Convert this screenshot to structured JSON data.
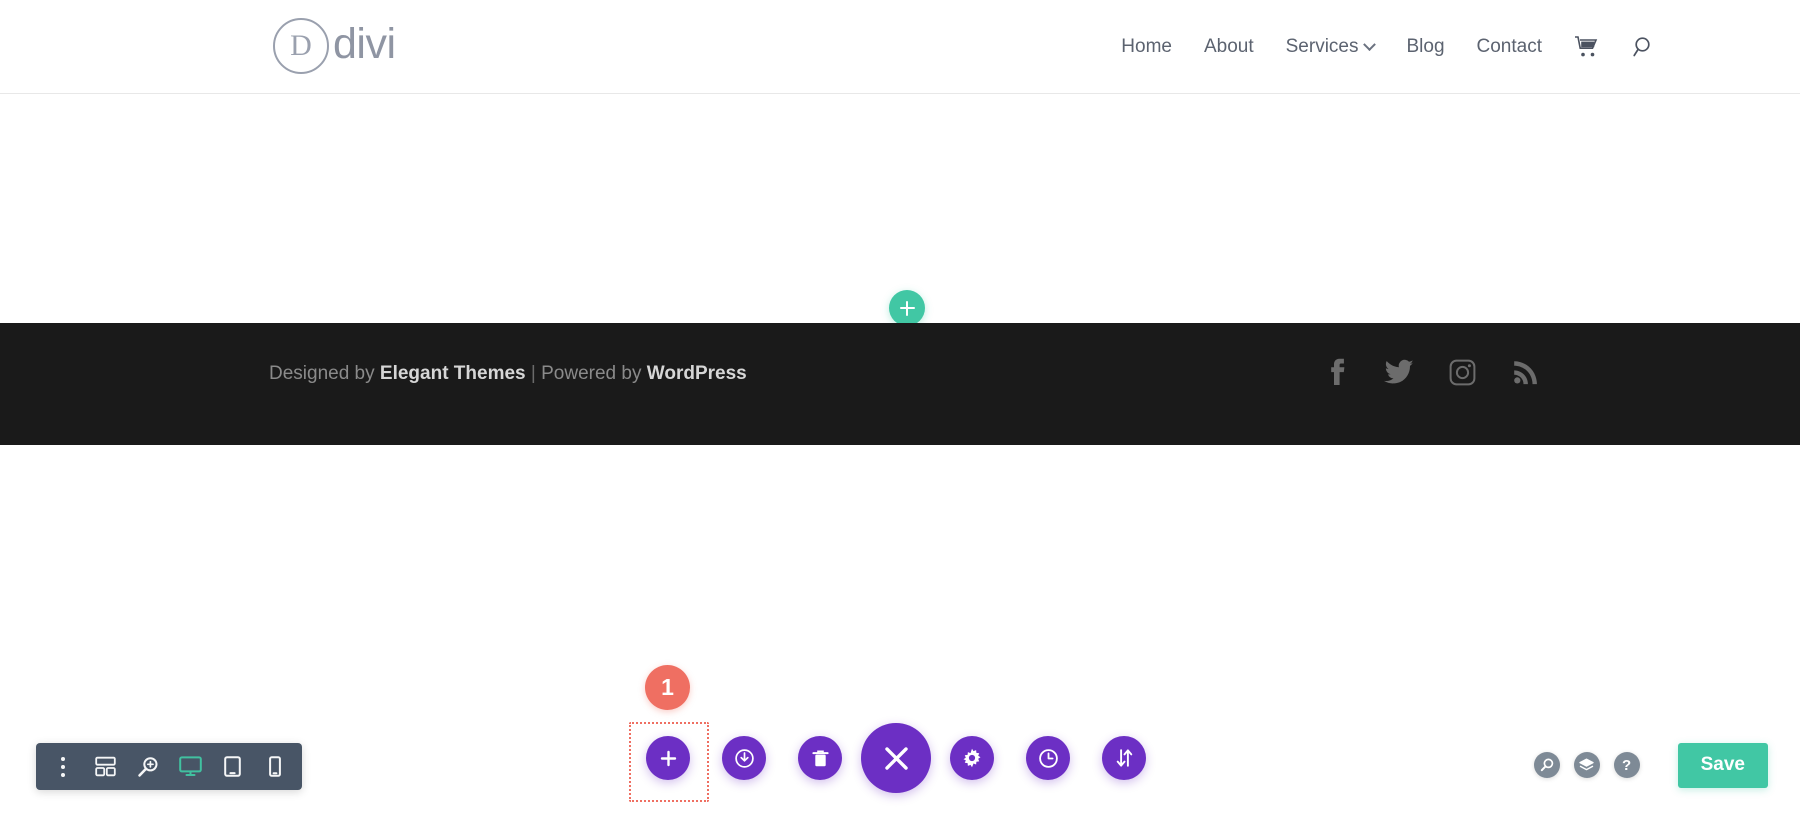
{
  "header": {
    "logo": {
      "mark": "D",
      "text": "divi",
      "icon": "divi-logo-icon"
    },
    "nav": [
      {
        "label": "Home",
        "has_caret": false
      },
      {
        "label": "About",
        "has_caret": false
      },
      {
        "label": "Services",
        "has_caret": true
      },
      {
        "label": "Blog",
        "has_caret": false
      },
      {
        "label": "Contact",
        "has_caret": false
      }
    ],
    "icons": [
      {
        "name": "cart-icon"
      },
      {
        "name": "search-icon"
      }
    ]
  },
  "canvas": {
    "add_section": {
      "icon": "plus-icon",
      "color": "#41c7a4"
    }
  },
  "footer": {
    "credit": {
      "prefix": "Designed by ",
      "brand1": "Elegant Themes",
      "separator": " | ",
      "middle": "Powered by ",
      "brand2": "WordPress"
    },
    "social": [
      {
        "name": "facebook-icon"
      },
      {
        "name": "twitter-icon"
      },
      {
        "name": "instagram-icon"
      },
      {
        "name": "rss-icon"
      }
    ],
    "background": "#1a1a1a"
  },
  "visual_builder": {
    "left_toolbar": [
      {
        "name": "more-options-icon",
        "label": "More Options",
        "active": false
      },
      {
        "name": "wireframe-view-icon",
        "label": "Wireframe View",
        "active": false
      },
      {
        "name": "zoom-out-view-icon",
        "label": "Zoom Out",
        "active": false
      },
      {
        "name": "desktop-view-icon",
        "label": "Desktop View",
        "active": true
      },
      {
        "name": "tablet-view-icon",
        "label": "Tablet View",
        "active": false
      },
      {
        "name": "phone-view-icon",
        "label": "Phone View",
        "active": false
      }
    ],
    "center_buttons": [
      {
        "name": "add-section-button",
        "icon": "plus-icon",
        "size": "sm",
        "selected": true
      },
      {
        "name": "page-settings-button",
        "icon": "power-save-icon",
        "size": "sm",
        "selected": false
      },
      {
        "name": "clear-layout-button",
        "icon": "trash-icon",
        "size": "sm",
        "selected": false
      },
      {
        "name": "close-builder-button",
        "icon": "close-x-icon",
        "size": "lg",
        "selected": false
      },
      {
        "name": "settings-button",
        "icon": "gear-icon",
        "size": "sm",
        "selected": false
      },
      {
        "name": "history-button",
        "icon": "clock-icon",
        "size": "sm",
        "selected": false
      },
      {
        "name": "portability-button",
        "icon": "sort-arrows-icon",
        "size": "sm",
        "selected": false
      }
    ],
    "step_badge": {
      "number": "1",
      "color": "#ef6f62"
    },
    "selection_highlight": {
      "color": "#ef6f62",
      "style": "dotted"
    },
    "right_controls": [
      {
        "name": "preview-zoom-icon",
        "icon": "magnifier-icon"
      },
      {
        "name": "layers-view-icon",
        "icon": "layers-icon"
      },
      {
        "name": "help-icon",
        "icon": "question-mark-icon",
        "glyph": "?"
      }
    ],
    "save_button": {
      "label": "Save",
      "color": "#41c7a4"
    },
    "accent_purple": "#6c2fc4"
  }
}
